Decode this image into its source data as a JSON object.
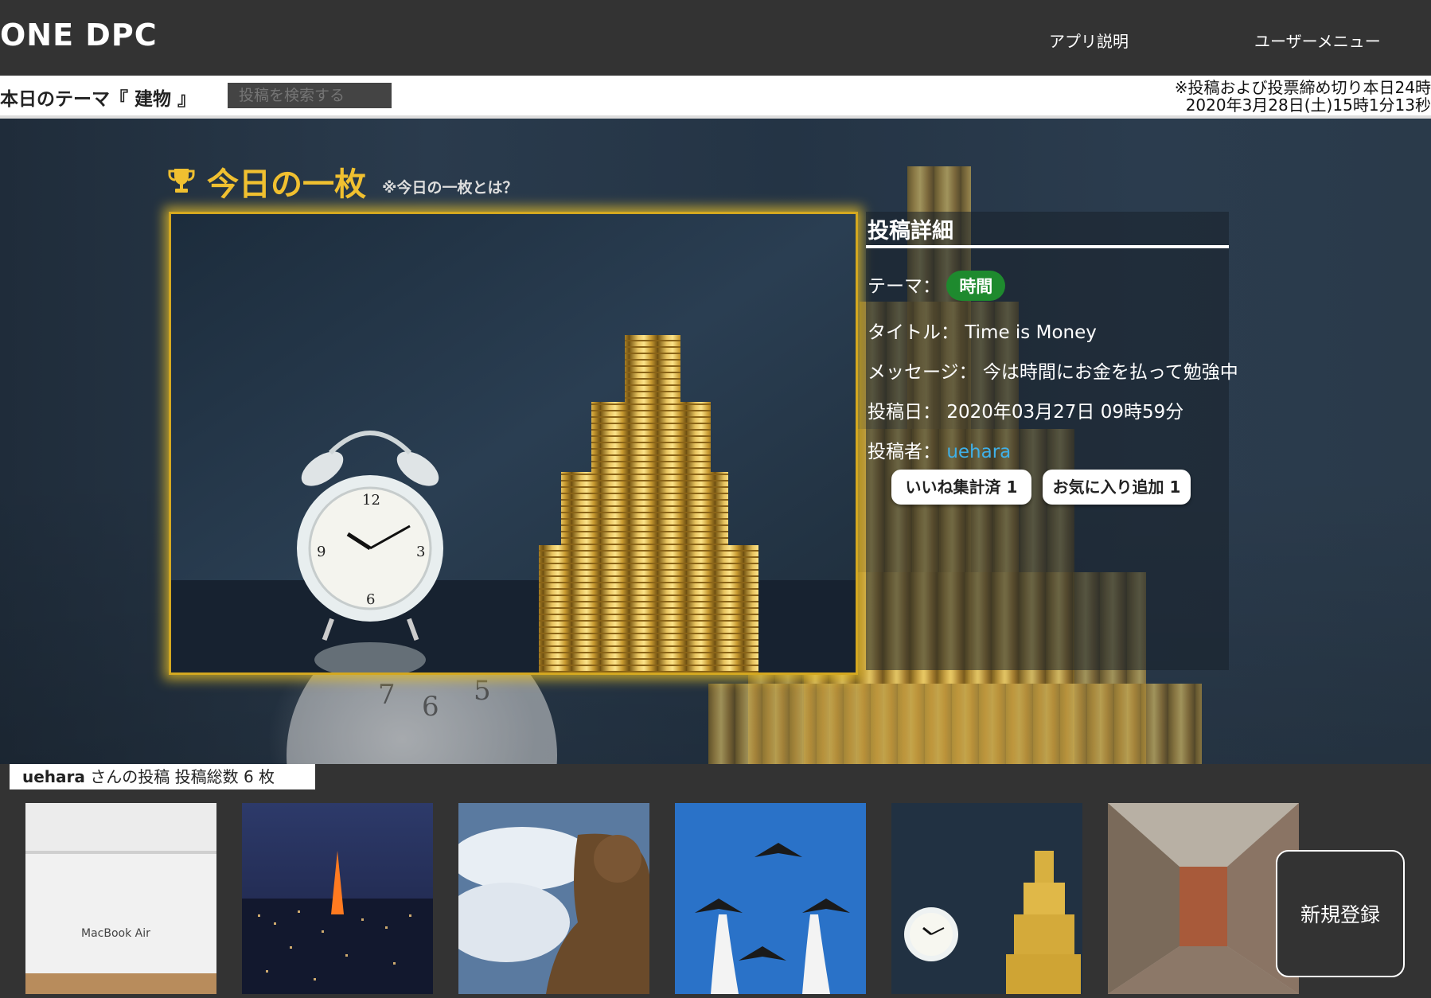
{
  "app": {
    "logo": "ONE DPC"
  },
  "nav": {
    "about": "アプリ説明",
    "user_menu": "ユーザーメニュー"
  },
  "theme_bar": {
    "theme_label": "本日のテーマ『 建物 』",
    "search_placeholder": "投稿を検索する",
    "deadline_line1": "※投稿および投票締め切り本日24時",
    "deadline_line2": "2020年3月28日(土)15時1分13秒"
  },
  "today": {
    "title": "今日の一枚",
    "help_link": "※今日の一枚とは？",
    "icon": "trophy-icon",
    "accent_color": "#f0c030"
  },
  "detail": {
    "heading": "投稿詳細",
    "theme_label": "テーマ：",
    "theme_value": "時間",
    "title_label": "タイトル：",
    "title_value": "Time is Money",
    "message_label": "メッセージ：",
    "message_value": "今は時間にお金を払って勉強中",
    "date_label": "投稿日：",
    "date_value": "2020年03月27日 09時59分",
    "author_label": "投稿者：",
    "author_value": "uehara",
    "like_button": "いいね集計済 1",
    "favorite_button": "お気に入り追加 1",
    "badge_color": "#1e8a2e",
    "link_color": "#3fb0e8"
  },
  "user_posts": {
    "username": "uehara",
    "summary": "さんの投稿 投稿総数 6 枚",
    "thumbnails": [
      {
        "name": "macbook-box",
        "caption": "MacBook Air"
      },
      {
        "name": "tokyo-night-skyline"
      },
      {
        "name": "thinker-statue"
      },
      {
        "name": "jets-formation"
      },
      {
        "name": "clock-and-coins"
      },
      {
        "name": "old-building-street"
      }
    ]
  },
  "new_button": "新規登録"
}
